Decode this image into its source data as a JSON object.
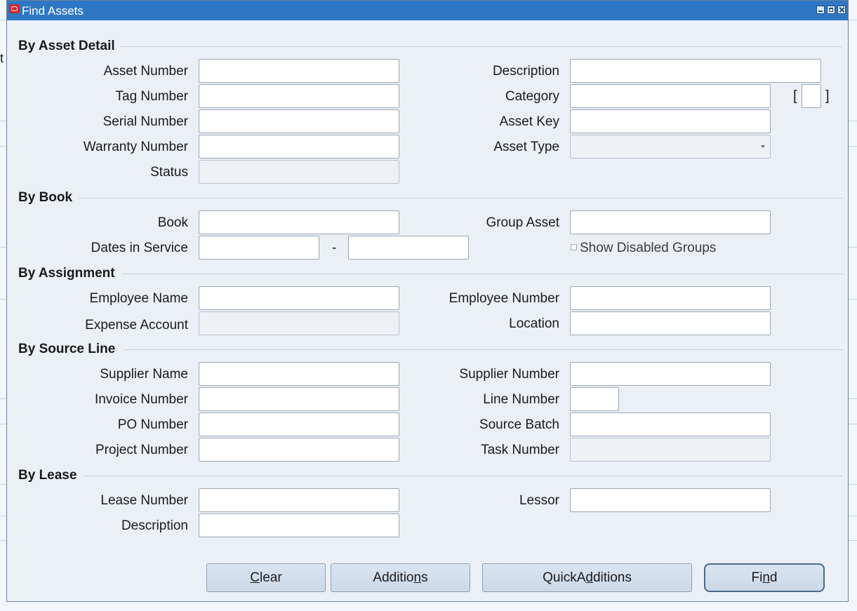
{
  "window": {
    "title": "Find Assets"
  },
  "background": {
    "stub_text": "t"
  },
  "sections": {
    "asset_detail": "By Asset Detail",
    "book": "By Book",
    "assignment": "By Assignment",
    "source_line": "By Source Line",
    "lease": "By Lease"
  },
  "asset_detail": {
    "asset_number": {
      "label": "Asset Number",
      "value": ""
    },
    "tag_number": {
      "label": "Tag Number",
      "value": ""
    },
    "serial_number": {
      "label": "Serial Number",
      "value": ""
    },
    "warranty_number": {
      "label": "Warranty Number",
      "value": ""
    },
    "status": {
      "label": "Status",
      "value": ""
    },
    "description": {
      "label": "Description",
      "value": ""
    },
    "category": {
      "label": "Category",
      "value": "",
      "flex_open": "[",
      "flex_close": "]"
    },
    "asset_key": {
      "label": "Asset Key",
      "value": ""
    },
    "asset_type": {
      "label": "Asset Type",
      "value": ""
    }
  },
  "book": {
    "book": {
      "label": "Book",
      "value": ""
    },
    "dates_in_service": {
      "label": "Dates in Service",
      "from": "",
      "to": "",
      "separator": "-"
    },
    "group_asset": {
      "label": "Group Asset",
      "value": ""
    },
    "show_disabled_groups": {
      "label": "Show Disabled Groups",
      "checked": false
    }
  },
  "assignment": {
    "employee_name": {
      "label": "Employee Name",
      "value": ""
    },
    "expense_account": {
      "label": "Expense Account",
      "value": ""
    },
    "employee_number": {
      "label": "Employee Number",
      "value": ""
    },
    "location": {
      "label": "Location",
      "value": ""
    }
  },
  "source_line": {
    "supplier_name": {
      "label": "Supplier Name",
      "value": ""
    },
    "invoice_number": {
      "label": "Invoice Number",
      "value": ""
    },
    "po_number": {
      "label": "PO Number",
      "value": ""
    },
    "project_number": {
      "label": "Project Number",
      "value": ""
    },
    "supplier_number": {
      "label": "Supplier Number",
      "value": ""
    },
    "line_number": {
      "label": "Line Number",
      "value": ""
    },
    "source_batch": {
      "label": "Source Batch",
      "value": ""
    },
    "task_number": {
      "label": "Task Number",
      "value": ""
    }
  },
  "lease": {
    "lease_number": {
      "label": "Lease Number",
      "value": ""
    },
    "description": {
      "label": "Description",
      "value": ""
    },
    "lessor": {
      "label": "Lessor",
      "value": ""
    }
  },
  "buttons": {
    "clear": {
      "pre": "",
      "mnemonic": "C",
      "post": "lear"
    },
    "additions": {
      "pre": "Additio",
      "mnemonic": "n",
      "post": "s"
    },
    "quick_additions": {
      "pre": "QuickA",
      "mnemonic": "d",
      "post": "ditions"
    },
    "find": {
      "pre": "Fi",
      "mnemonic": "n",
      "post": "d"
    }
  },
  "colors": {
    "titlebar": "#2e77c4",
    "dialog_bg": "#ebf0f7",
    "button_bg": "#d2deeb"
  }
}
